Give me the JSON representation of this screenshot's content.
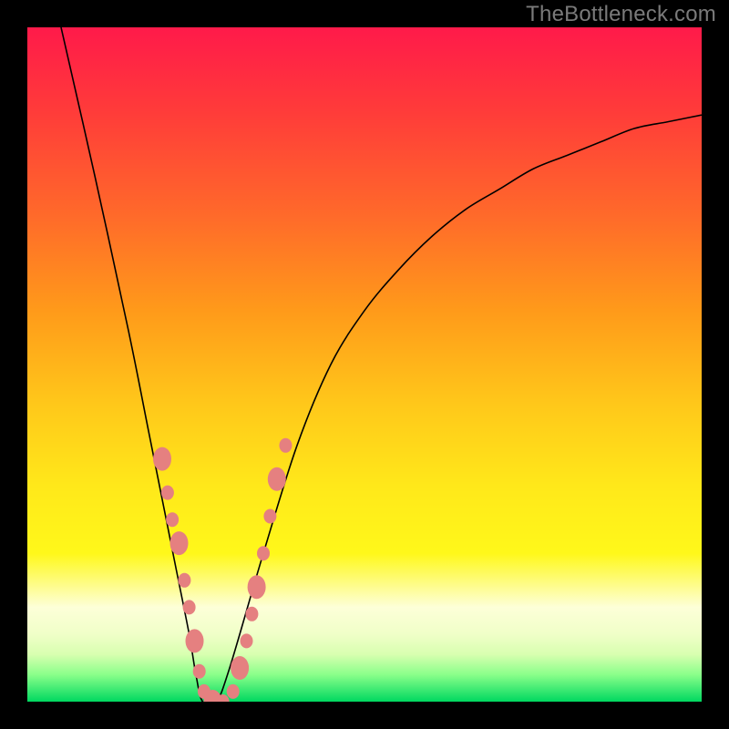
{
  "watermark": "TheBottleneck.com",
  "chart_data": {
    "type": "line",
    "title": "",
    "xlabel": "",
    "ylabel": "",
    "xlim": [
      0,
      100
    ],
    "ylim": [
      0,
      100
    ],
    "grid": false,
    "legend": false,
    "series": [
      {
        "name": "bottleneck-curve",
        "x": [
          5,
          10,
          15,
          18,
          20,
          22,
          24,
          25,
          26,
          28,
          30,
          35,
          40,
          45,
          50,
          55,
          60,
          65,
          70,
          75,
          80,
          85,
          90,
          95,
          100
        ],
        "y": [
          100,
          78,
          55,
          40,
          30,
          20,
          10,
          4,
          0,
          0,
          5,
          22,
          38,
          50,
          58,
          64,
          69,
          73,
          76,
          79,
          81,
          83,
          85,
          86,
          87
        ]
      }
    ],
    "markers": {
      "name": "data-points",
      "points": [
        {
          "x": 20.0,
          "y": 36.0
        },
        {
          "x": 20.8,
          "y": 31.0
        },
        {
          "x": 21.5,
          "y": 27.0
        },
        {
          "x": 22.5,
          "y": 23.5
        },
        {
          "x": 23.3,
          "y": 18.0
        },
        {
          "x": 24.0,
          "y": 14.0
        },
        {
          "x": 24.8,
          "y": 9.0
        },
        {
          "x": 25.5,
          "y": 4.5
        },
        {
          "x": 26.2,
          "y": 1.5
        },
        {
          "x": 27.5,
          "y": 0.0
        },
        {
          "x": 29.0,
          "y": 0.0
        },
        {
          "x": 30.5,
          "y": 1.5
        },
        {
          "x": 31.5,
          "y": 5.0
        },
        {
          "x": 32.5,
          "y": 9.0
        },
        {
          "x": 33.3,
          "y": 13.0
        },
        {
          "x": 34.0,
          "y": 17.0
        },
        {
          "x": 35.0,
          "y": 22.0
        },
        {
          "x": 36.0,
          "y": 27.5
        },
        {
          "x": 37.0,
          "y": 33.0
        },
        {
          "x": 38.3,
          "y": 38.0
        }
      ]
    },
    "background_gradient": {
      "top": "#ff1a4a",
      "middle": "#ffe81a",
      "bottom": "#00d860"
    }
  }
}
